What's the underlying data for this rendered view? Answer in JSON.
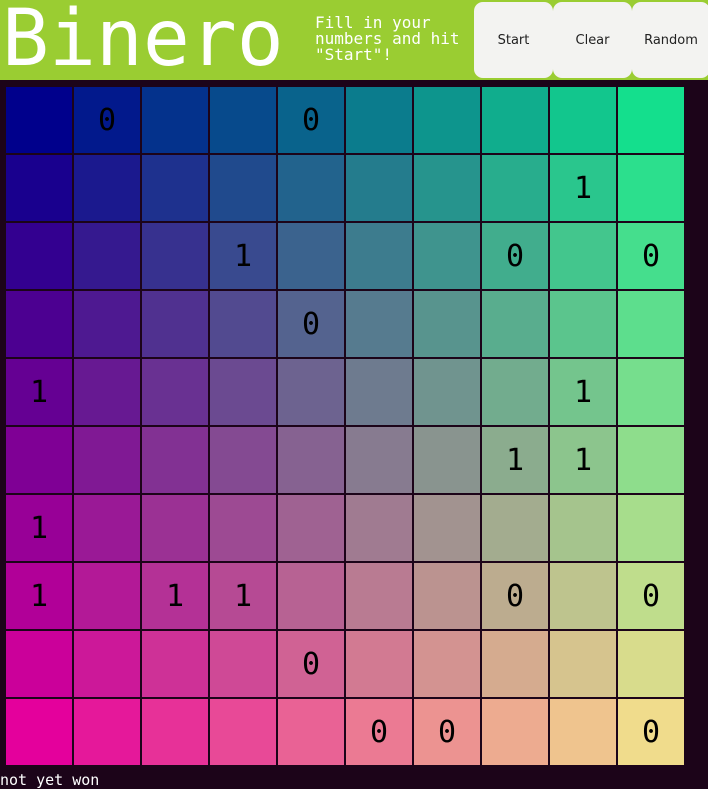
{
  "header": {
    "title": "Binero",
    "instructions": "Fill in your\nnumbers and hit\n\"Start\"!"
  },
  "buttons": {
    "start": "Start",
    "clear": "Clear",
    "random": "Random"
  },
  "colors": {
    "header_bg": "#9acd32",
    "page_bg": "#1c0419",
    "grid_corner_top_left": "#00008c",
    "grid_corner_top_right": "#14df8d",
    "grid_corner_bottom_left": "#e4009c",
    "grid_corner_bottom_right": "#f0dc8c"
  },
  "grid": {
    "size": 10,
    "rows": [
      [
        "",
        "0",
        "",
        "",
        "0",
        "",
        "",
        "",
        "",
        ""
      ],
      [
        "",
        "",
        "",
        "",
        "",
        "",
        "",
        "",
        "1",
        ""
      ],
      [
        "",
        "",
        "",
        "1",
        "",
        "",
        "",
        "0",
        "",
        "0"
      ],
      [
        "",
        "",
        "",
        "",
        "0",
        "",
        "",
        "",
        "",
        ""
      ],
      [
        "1",
        "",
        "",
        "",
        "",
        "",
        "",
        "",
        "1",
        ""
      ],
      [
        "",
        "",
        "",
        "",
        "",
        "",
        "",
        "1",
        "1",
        ""
      ],
      [
        "1",
        "",
        "",
        "",
        "",
        "",
        "",
        "",
        "",
        ""
      ],
      [
        "1",
        "",
        "1",
        "1",
        "",
        "",
        "",
        "0",
        "",
        "0"
      ],
      [
        "",
        "",
        "",
        "",
        "0",
        "",
        "",
        "",
        "",
        ""
      ],
      [
        "",
        "",
        "",
        "",
        "",
        "0",
        "0",
        "",
        "",
        "0"
      ]
    ]
  },
  "status": "not yet won"
}
